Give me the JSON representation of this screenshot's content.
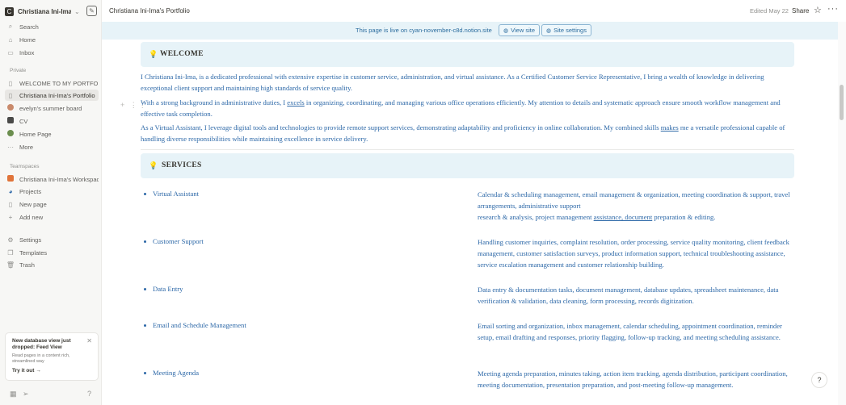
{
  "sidebar": {
    "workspace_initial": "C",
    "workspace_name": "Christiana Ini-Ima's Notion",
    "nav": [
      {
        "label": "Search",
        "icon": "search-icon"
      },
      {
        "label": "Home",
        "icon": "home-icon"
      },
      {
        "label": "Inbox",
        "icon": "inbox-icon"
      }
    ],
    "private_label": "Private",
    "private_pages": [
      {
        "label": "WELCOME TO MY PORTFOLIO",
        "icon": "page-icon"
      },
      {
        "label": "Christiana Ini-Ima's Portfolio",
        "icon": "page-icon"
      },
      {
        "label": "evelyn's summer board",
        "icon": "emoji-icon"
      },
      {
        "label": "CV",
        "icon": "folder-icon"
      },
      {
        "label": "Home Page",
        "icon": "emoji-icon"
      }
    ],
    "more_label": "More",
    "teamspaces_label": "Teamspaces",
    "team_items": [
      {
        "label": "Christiana Ini-Ima's Workspace",
        "icon": "workspace-icon"
      },
      {
        "label": "Projects",
        "icon": "projects-icon"
      },
      {
        "label": "New page",
        "icon": "page-icon"
      },
      {
        "label": "Add new",
        "icon": "plus-icon"
      }
    ],
    "footer_items": [
      {
        "label": "Settings",
        "icon": "gear-icon"
      },
      {
        "label": "Templates",
        "icon": "templates-icon"
      },
      {
        "label": "Trash",
        "icon": "trash-icon"
      }
    ],
    "promo": {
      "title": "New database view just dropped: Feed View",
      "desc": "Read pages in a content rich, streamlined way",
      "action": "Try it out"
    }
  },
  "topbar": {
    "breadcrumb": "Christiana Ini-Ima's Portfolio",
    "edited": "Edited May 22",
    "share": "Share"
  },
  "banner": {
    "text": "This page is live on cyan-november-c8d.notion.site",
    "view_site": "View site",
    "site_settings": "Site settings"
  },
  "welcome": {
    "heading": "WELCOME",
    "p1": "I Christiana Ini-Ima, is a dedicated professional with extensive expertise in customer service, administration, and virtual assistance. As a Certified Customer Service Representative, I bring a wealth of knowledge in delivering exceptional client support and maintaining high standards of service quality.",
    "p2_a": "With a strong background in administrative duties, I ",
    "p2_u": "excels",
    "p2_b": " in organizing, coordinating, and managing various office operations efficiently. My attention to details and systematic approach ensure smooth workflow management and effective task completion.",
    "p3_a": "As a Virtual Assistant, I leverage digital tools and technologies to provide remote support services, demonstrating adaptability and proficiency in online collaboration. My combined skills ",
    "p3_u": "makes",
    "p3_b": " me a versatile professional capable of handling diverse responsibilities while maintaining excellence in service delivery."
  },
  "services": {
    "heading": "SERVICES",
    "items": [
      {
        "title": "Virtual Assistant",
        "desc_a": "Calendar & scheduling management, email management & organization, meeting coordination & support, travel arrangements, administrative support",
        "desc_b": " research & analysis, project management ",
        "desc_u": "assistance,  document",
        "desc_c": " preparation & editing."
      },
      {
        "title": "Customer Support",
        "desc": "Handling customer inquiries, complaint resolution, order processing, service quality monitoring, client feedback management, customer satisfaction surveys, product information support, technical troubleshooting assistance, service escalation management and customer relationship building."
      },
      {
        "title": "Data Entry",
        "desc": "Data entry & documentation tasks, document management, database updates, spreadsheet maintenance, data verification & validation, data cleaning, form processing, records digitization."
      },
      {
        "title": "Email and Schedule Management",
        "desc": "Email sorting and organization, inbox management, calendar scheduling, appointment coordination, reminder setup, email drafting and responses, priority flagging, follow-up tracking, and meeting scheduling assistance."
      },
      {
        "title": "Meeting Agenda",
        "desc": "Meeting agenda preparation, minutes taking, action item tracking, agenda distribution, participant coordination, meeting documentation, presentation preparation, and post-meeting follow-up management."
      }
    ]
  },
  "colors": {
    "text_blue": "#2e69a8",
    "callout_bg": "#e7f3f8",
    "sidebar_bg": "#f7f7f5"
  }
}
